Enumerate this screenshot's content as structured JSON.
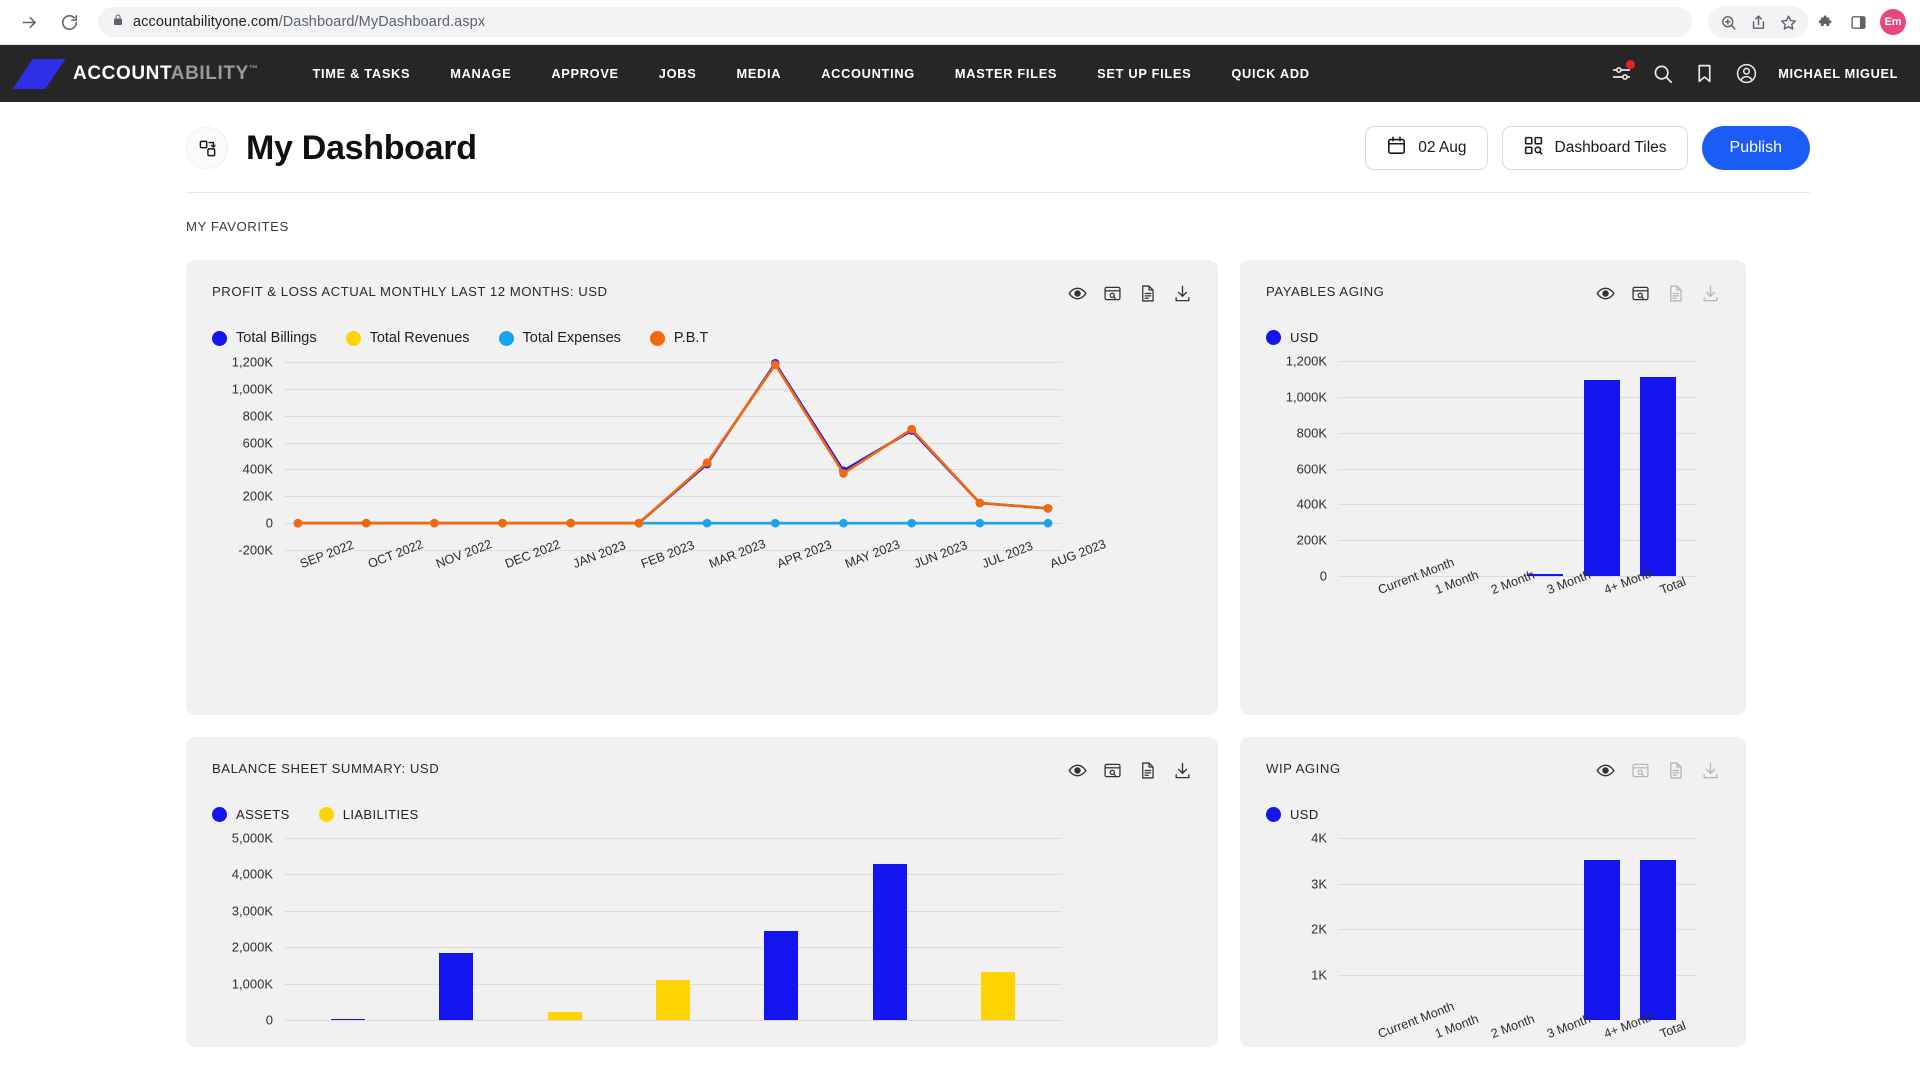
{
  "browser": {
    "url_domain": "accountabilityone.com",
    "url_path": "/Dashboard/MyDashboard.aspx",
    "icons": {
      "forward": "forward-arrow-icon",
      "reload": "reload-icon",
      "lock": "lock-icon",
      "zoom": "zoom-icon",
      "share": "share-icon",
      "bookmark": "star-icon",
      "extensions": "puzzle-icon",
      "sidepanel": "side-panel-icon"
    },
    "profile_initials": "Em"
  },
  "appnav": {
    "brand_part1": "ACCOUNT",
    "brand_part2": "ABILITY",
    "brand_tm": "™",
    "menu": [
      "TIME & TASKS",
      "MANAGE",
      "APPROVE",
      "JOBS",
      "MEDIA",
      "ACCOUNTING",
      "MASTER FILES",
      "SET UP FILES",
      "QUICK ADD"
    ],
    "user": "MICHAEL MIGUEL",
    "has_notification_badge": true
  },
  "header": {
    "title": "My Dashboard",
    "date_button": "02 Aug",
    "tiles_button": "Dashboard Tiles",
    "publish_button": "Publish"
  },
  "section": {
    "favorites_label": "MY FAVORITES"
  },
  "colors": {
    "accent_blue": "#1a5cf5",
    "series_blue": "#1414f0",
    "series_yellow": "#ffd400",
    "series_lightblue": "#19a3ef",
    "series_orange": "#f2690d",
    "nav_dark": "#262626",
    "card_bg": "#f1f1f1"
  },
  "chart_data": [
    {
      "id": "profit-loss",
      "type": "line",
      "title": "PROFIT & LOSS ACTUAL MONTHLY LAST 12 MONTHS: USD",
      "xlabel": "",
      "ylabel": "",
      "ylim": [
        -200000,
        1200000
      ],
      "yticks": [
        1200000,
        1000000,
        800000,
        600000,
        400000,
        200000,
        0,
        -200000
      ],
      "ytick_labels": [
        "1,200K",
        "1,000K",
        "800K",
        "600K",
        "400K",
        "200K",
        "0",
        "-200K"
      ],
      "grid": true,
      "legend_position": "top-left",
      "categories": [
        "SEP 2022",
        "OCT 2022",
        "NOV 2022",
        "DEC 2022",
        "JAN 2023",
        "FEB 2023",
        "MAR 2023",
        "APR 2023",
        "MAY 2023",
        "JUN 2023",
        "JUL 2023",
        "AUG 2023"
      ],
      "series": [
        {
          "name": "Total Billings",
          "color": "#1414f0",
          "values": [
            0,
            0,
            0,
            0,
            0,
            0,
            440000,
            1190000,
            390000,
            690000,
            150000,
            110000
          ]
        },
        {
          "name": "Total Revenues",
          "color": "#ffd400",
          "values": [
            0,
            0,
            0,
            0,
            0,
            0,
            0,
            0,
            0,
            0,
            0,
            0
          ]
        },
        {
          "name": "Total Expenses",
          "color": "#19a3ef",
          "values": [
            0,
            0,
            0,
            0,
            0,
            0,
            0,
            0,
            0,
            0,
            0,
            0
          ]
        },
        {
          "name": "P.B.T",
          "color": "#f2690d",
          "values": [
            0,
            0,
            0,
            0,
            0,
            0,
            450000,
            1180000,
            370000,
            700000,
            150000,
            110000
          ]
        }
      ]
    },
    {
      "id": "payables-aging",
      "type": "bar",
      "title": "PAYABLES AGING",
      "legend": [
        "USD"
      ],
      "legend_position": "top-left",
      "ylim": [
        0,
        1200000
      ],
      "yticks": [
        1200000,
        1000000,
        800000,
        600000,
        400000,
        200000,
        0
      ],
      "ytick_labels": [
        "1,200K",
        "1,000K",
        "800K",
        "600K",
        "400K",
        "200K",
        "0"
      ],
      "grid": true,
      "categories": [
        "Current Month",
        "1 Month",
        "2 Month",
        "3 Month",
        "4+ Month",
        "Total"
      ],
      "values": [
        0,
        0,
        0,
        12000,
        1095000,
        1110000
      ],
      "color": "#1414f0"
    },
    {
      "id": "balance-sheet",
      "type": "bar",
      "title": "BALANCE SHEET SUMMARY: USD",
      "legend": [
        "ASSETS",
        "LIABILITIES"
      ],
      "legend_position": "top-left",
      "ylim": [
        0,
        5000000
      ],
      "yticks": [
        5000000,
        4000000,
        3000000,
        2000000,
        1000000,
        0
      ],
      "ytick_labels": [
        "5,000K",
        "4,000K",
        "3,000K",
        "2,000K",
        "1,000K",
        "0"
      ],
      "grid": true,
      "categories": [
        "",
        "",
        "",
        "",
        "",
        "",
        ""
      ],
      "bars": [
        {
          "series": "ASSETS",
          "value": 25000,
          "color": "#1414f0"
        },
        {
          "series": "ASSETS",
          "value": 1840000,
          "color": "#1414f0"
        },
        {
          "series": "LIABILITIES",
          "value": 220000,
          "color": "#ffd400"
        },
        {
          "series": "LIABILITIES",
          "value": 1110000,
          "color": "#ffd400"
        },
        {
          "series": "ASSETS",
          "value": 2450000,
          "color": "#1414f0"
        },
        {
          "series": "ASSETS",
          "value": 4280000,
          "color": "#1414f0"
        },
        {
          "series": "LIABILITIES",
          "value": 1330000,
          "color": "#ffd400"
        }
      ]
    },
    {
      "id": "wip-aging",
      "type": "bar",
      "title": "WIP AGING",
      "legend": [
        "USD"
      ],
      "legend_position": "top-left",
      "ylim": [
        0,
        4000
      ],
      "yticks": [
        4000,
        3000,
        2000,
        1000
      ],
      "ytick_labels": [
        "4K",
        "3K",
        "2K",
        "1K"
      ],
      "grid": true,
      "categories": [
        "Current Month",
        "1 Month",
        "2 Month",
        "3 Month",
        "4+ Month",
        "Total"
      ],
      "values": [
        0,
        0,
        0,
        0,
        3520,
        3520
      ],
      "color": "#1414f0"
    }
  ]
}
